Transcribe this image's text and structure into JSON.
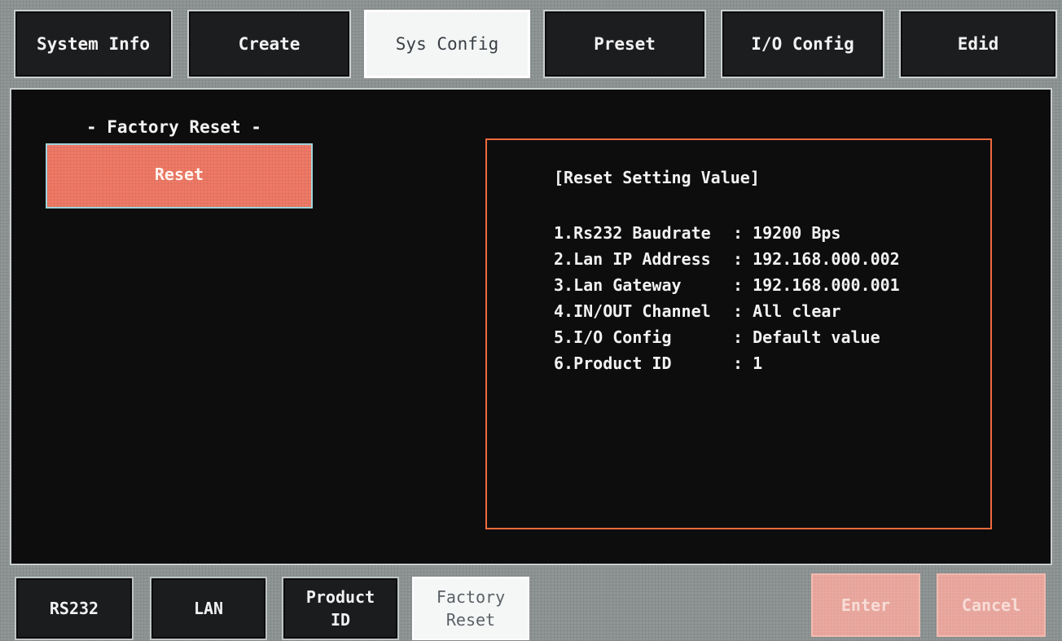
{
  "top_tabs": [
    {
      "label": "System Info"
    },
    {
      "label": "Create"
    },
    {
      "label": "Sys Config"
    },
    {
      "label": "Preset"
    },
    {
      "label": "I/O Config"
    },
    {
      "label": "Edid"
    }
  ],
  "active_top_tab": "Sys Config",
  "panel": {
    "section_title": "- Factory Reset -",
    "reset_button": "Reset"
  },
  "info": {
    "title": "[Reset Setting Value]",
    "rows": [
      {
        "label": "1.Rs232 Baudrate",
        "value": ": 19200 Bps"
      },
      {
        "label": "2.Lan IP Address",
        "value": ": 192.168.000.002"
      },
      {
        "label": "3.Lan Gateway",
        "value": ": 192.168.000.001"
      },
      {
        "label": "4.IN/OUT Channel",
        "value": ": All clear"
      },
      {
        "label": "5.I/O Config",
        "value": ": Default value"
      },
      {
        "label": "6.Product ID",
        "value": ": 1"
      }
    ]
  },
  "bottom_tabs": [
    {
      "line1": "RS232",
      "line2": ""
    },
    {
      "line1": "LAN",
      "line2": ""
    },
    {
      "line1": "Product",
      "line2": "ID"
    },
    {
      "line1": "Factory",
      "line2": "Reset"
    }
  ],
  "active_bottom_tab": "Factory Reset",
  "actions": {
    "enter": "Enter",
    "cancel": "Cancel"
  },
  "colors": {
    "reset_button": "#ef7a66",
    "info_border": "#ee6a3c",
    "action_buttons": "#e7a39a",
    "panel_background": "#0d0d0e"
  }
}
